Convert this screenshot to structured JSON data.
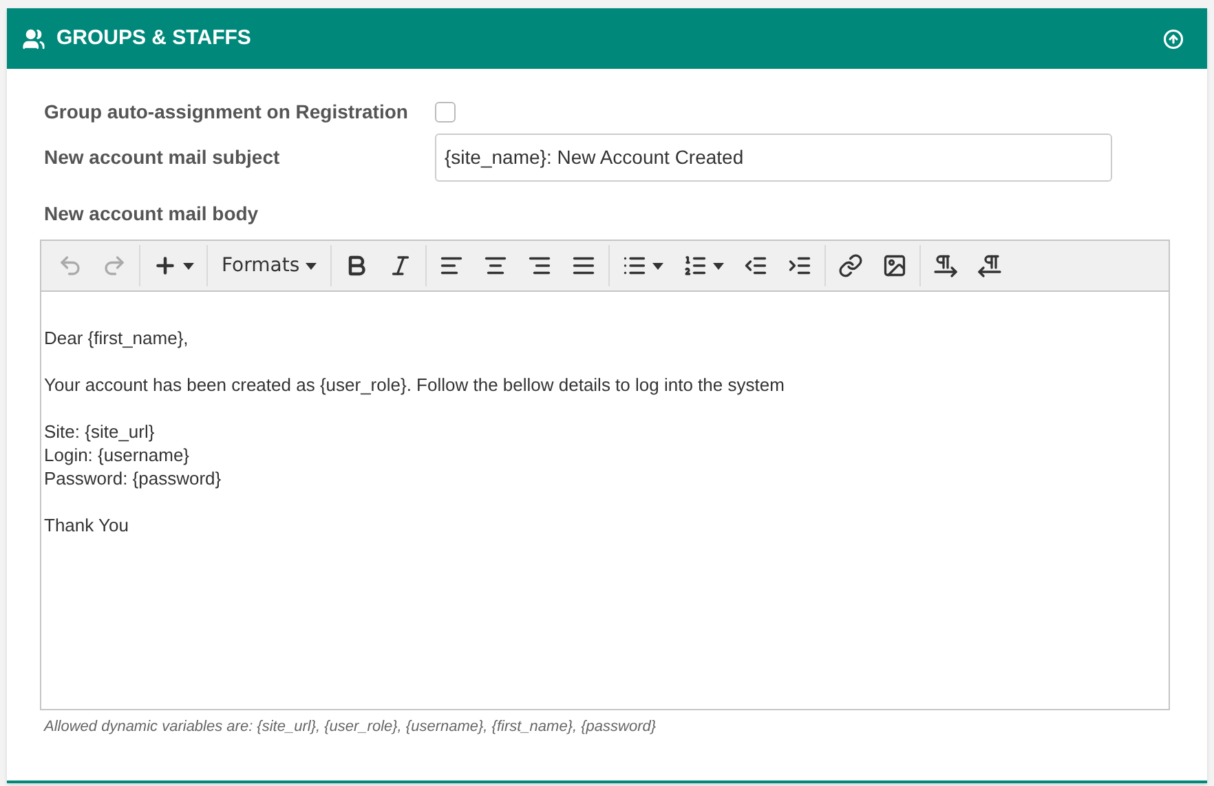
{
  "panel": {
    "title": "GROUPS & STAFFS"
  },
  "fields": [
    {
      "kind": "checkbox",
      "label": "Group auto-assignment on Registration",
      "checked": false
    },
    {
      "kind": "text",
      "label": "New account mail subject",
      "value": "{site_name}: New Account Created"
    },
    {
      "kind": "label",
      "label": "New account mail body"
    }
  ],
  "toolbar": [
    [
      {
        "kind": "undo",
        "disabled": true
      },
      {
        "kind": "redo",
        "disabled": true
      }
    ],
    [
      {
        "kind": "insert",
        "disabled": false,
        "dropdown": true
      }
    ],
    [
      {
        "kind": "formats",
        "label": "Formats",
        "disabled": false,
        "dropdown": true
      }
    ],
    [
      {
        "kind": "bold",
        "disabled": false
      },
      {
        "kind": "italic",
        "disabled": false
      }
    ],
    [
      {
        "kind": "align-left",
        "disabled": false
      },
      {
        "kind": "align-center",
        "disabled": false
      },
      {
        "kind": "align-right",
        "disabled": false
      },
      {
        "kind": "align-justify",
        "disabled": false
      }
    ],
    [
      {
        "kind": "bullet-list",
        "disabled": false,
        "dropdown": true
      },
      {
        "kind": "numbered-list",
        "disabled": false,
        "dropdown": true
      },
      {
        "kind": "outdent",
        "disabled": false
      },
      {
        "kind": "indent",
        "disabled": false
      }
    ],
    [
      {
        "kind": "link",
        "disabled": false
      },
      {
        "kind": "image",
        "disabled": false
      }
    ],
    [
      {
        "kind": "ltr",
        "disabled": false
      },
      {
        "kind": "rtl",
        "disabled": false
      }
    ]
  ],
  "body": [
    [
      "Dear {first_name},"
    ],
    [
      "Your account has been created as {user_role}. Follow the bellow details to log into the system"
    ],
    [
      "Site: {site_url}",
      "Login: {username}",
      "Password: {password}"
    ],
    [
      "Thank You"
    ]
  ],
  "hint": "Allowed dynamic variables are: {site_url}, {user_role}, {username}, {first_name}, {password}"
}
